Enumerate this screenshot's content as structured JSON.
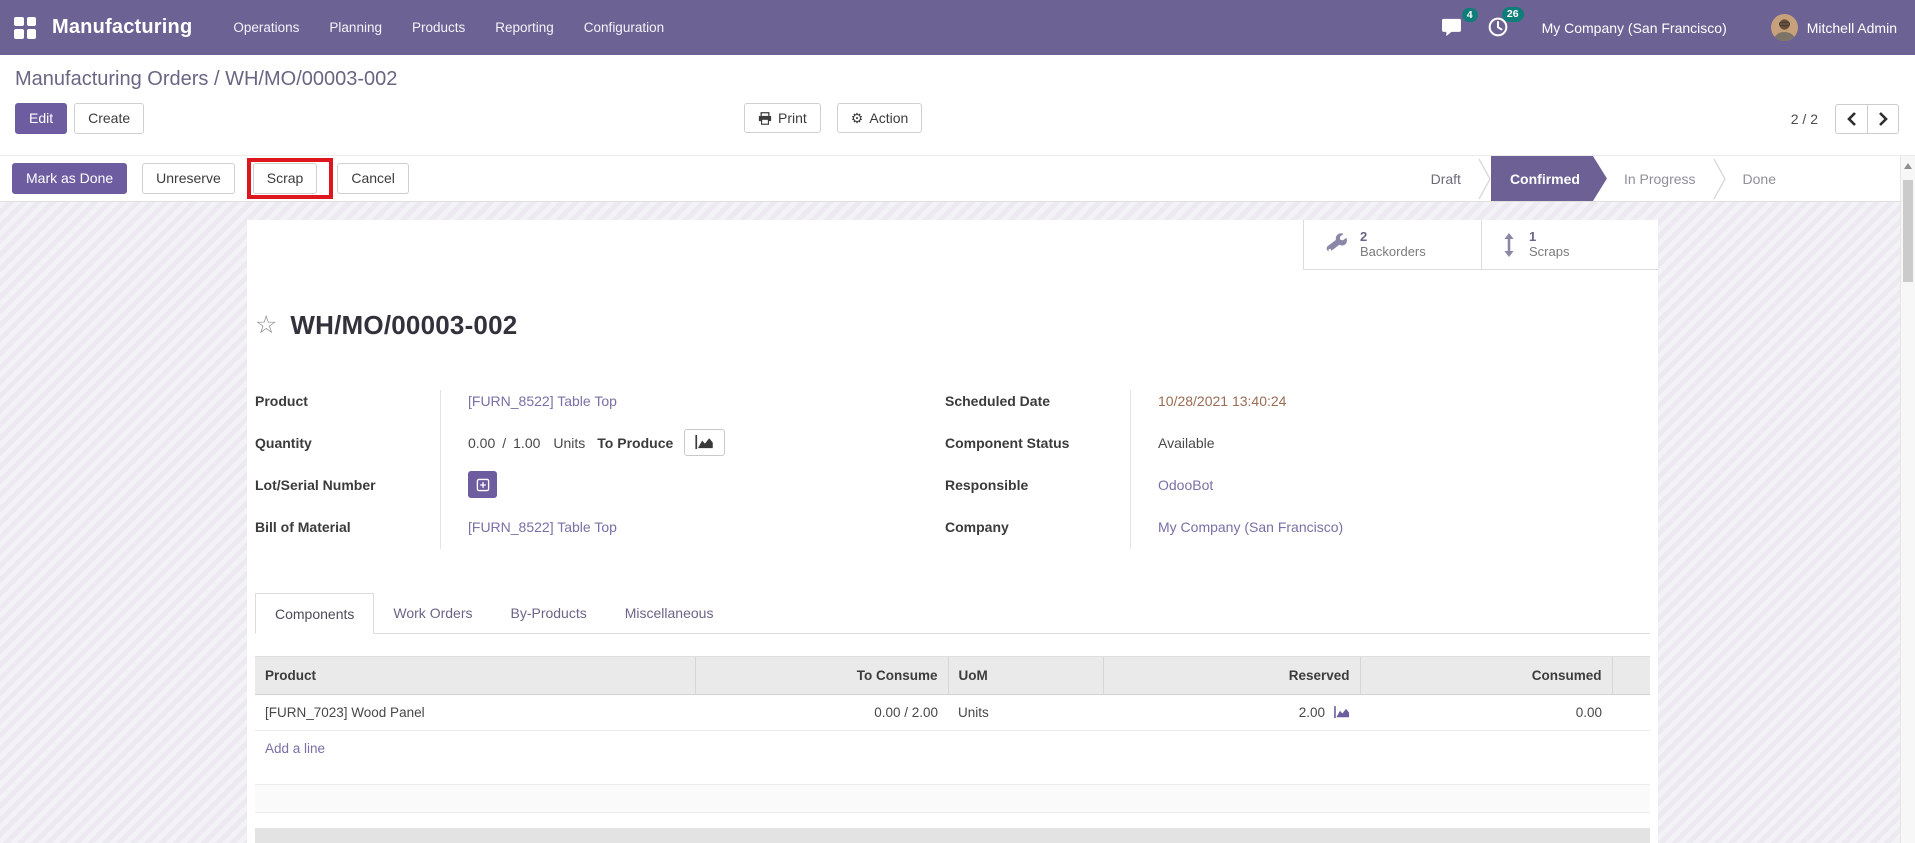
{
  "colors": {
    "navbar-bg": "#6c6394",
    "primary": "#6d5da0",
    "link": "#7a6fa6",
    "badge": "#0f7d79",
    "date-text": "#9a6c53",
    "annotation": "#e0161f",
    "stage-active": "#6c6094"
  },
  "navbar": {
    "app_name": "Manufacturing",
    "menus": [
      {
        "label": "Operations"
      },
      {
        "label": "Planning"
      },
      {
        "label": "Products"
      },
      {
        "label": "Reporting"
      },
      {
        "label": "Configuration"
      }
    ],
    "messages_badge": "4",
    "activities_badge": "26",
    "company": "My Company (San Francisco)",
    "user_name": "Mitchell Admin"
  },
  "breadcrumb": {
    "parent": "Manufacturing Orders",
    "separator": " / ",
    "current": "WH/MO/00003-002"
  },
  "control_panel": {
    "edit_label": "Edit",
    "create_label": "Create",
    "print_label": "Print",
    "action_label": "Action",
    "pager_value": "2 / 2"
  },
  "statusbar": {
    "mark_as_done_label": "Mark as Done",
    "unreserve_label": "Unreserve",
    "scrap_label": "Scrap",
    "cancel_label": "Cancel",
    "active_stage": "Confirmed",
    "stages": [
      {
        "label": "Draft"
      },
      {
        "label": "Confirmed"
      },
      {
        "label": "In Progress"
      },
      {
        "label": "Done"
      }
    ]
  },
  "smart_buttons": [
    {
      "icon": "wrench-icon",
      "count": "2",
      "label": "Backorders"
    },
    {
      "icon": "arrows-v-icon",
      "count": "1",
      "label": "Scraps"
    }
  ],
  "sheet": {
    "title": "WH/MO/00003-002",
    "fields": {
      "product": {
        "label": "Product",
        "value": "[FURN_8522] Table Top"
      },
      "quantity": {
        "label": "Quantity",
        "produced": "0.00",
        "separator": "/",
        "to_produce": "1.00",
        "uom": "Units",
        "annotation": "To Produce"
      },
      "lot": {
        "label": "Lot/Serial Number"
      },
      "bom": {
        "label": "Bill of Material",
        "value": "[FURN_8522] Table Top"
      },
      "scheduled_date": {
        "label": "Scheduled Date",
        "value": "10/28/2021 13:40:24"
      },
      "component_status": {
        "label": "Component Status",
        "value": "Available"
      },
      "responsible": {
        "label": "Responsible",
        "value": "OdooBot"
      },
      "company": {
        "label": "Company",
        "value": "My Company (San Francisco)"
      }
    },
    "active_tab": "Components",
    "tabs": [
      {
        "label": "Components"
      },
      {
        "label": "Work Orders"
      },
      {
        "label": "By-Products"
      },
      {
        "label": "Miscellaneous"
      }
    ],
    "components_table": {
      "columns": [
        {
          "label": "Product"
        },
        {
          "label": "To Consume"
        },
        {
          "label": "UoM"
        },
        {
          "label": "Reserved"
        },
        {
          "label": "Consumed"
        }
      ],
      "rows": [
        {
          "product": "[FURN_7023] Wood Panel",
          "to_consume": "0.00 / 2.00",
          "uom": "Units",
          "reserved": "2.00",
          "consumed": "0.00"
        }
      ],
      "add_line_label": "Add a line"
    }
  }
}
